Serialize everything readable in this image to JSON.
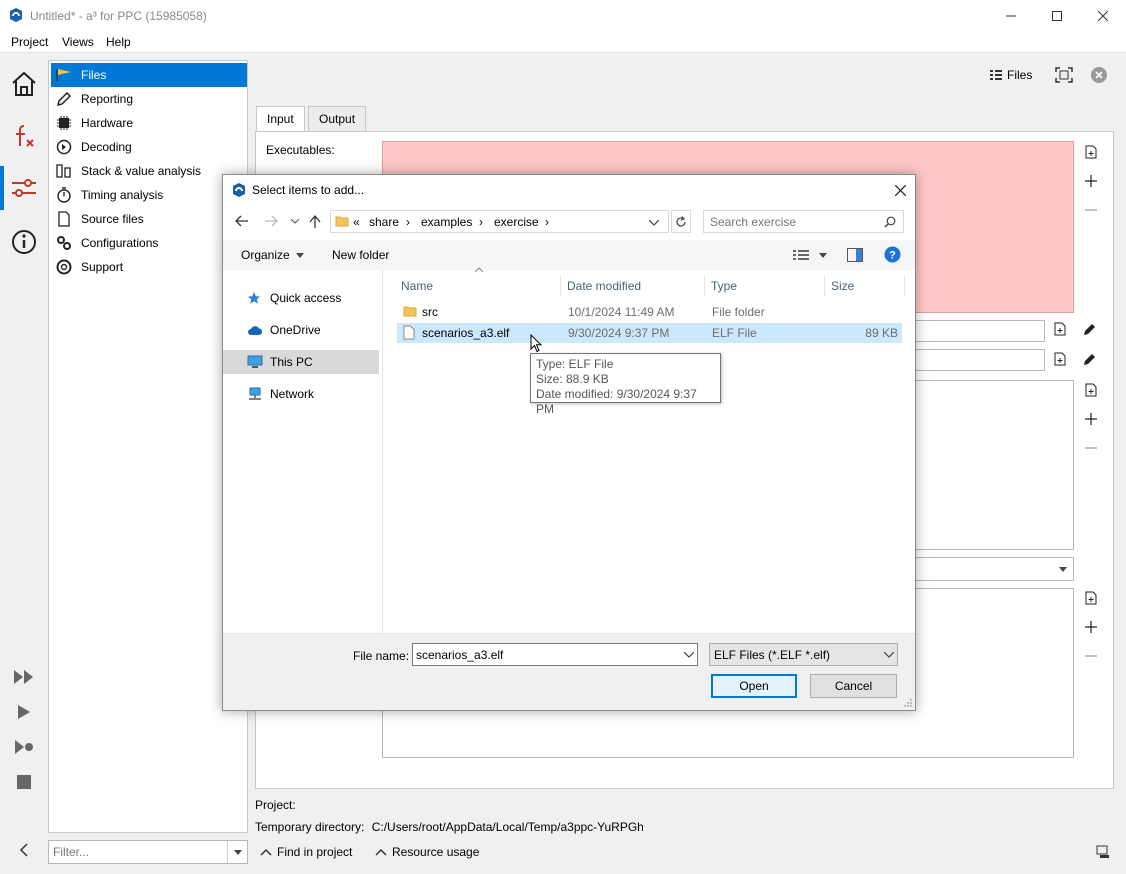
{
  "window": {
    "title": "Untitled* - a³ for PPC (15985058)"
  },
  "menu": [
    "Project",
    "Views",
    "Help"
  ],
  "nav": {
    "items": [
      {
        "label": "Files",
        "icon": "flag-icon"
      },
      {
        "label": "Reporting",
        "icon": "pencil-icon"
      },
      {
        "label": "Hardware",
        "icon": "chip-icon"
      },
      {
        "label": "Decoding",
        "icon": "decode-icon"
      },
      {
        "label": "Stack & value analysis",
        "icon": "stack-icon"
      },
      {
        "label": "Timing analysis",
        "icon": "stopwatch-icon"
      },
      {
        "label": "Source files",
        "icon": "document-icon"
      },
      {
        "label": "Configurations",
        "icon": "gears-icon"
      },
      {
        "label": "Support",
        "icon": "lifebuoy-icon"
      }
    ],
    "filter_placeholder": "Filter..."
  },
  "toolbar": {
    "files_label": "Files"
  },
  "tabs": [
    "Input",
    "Output"
  ],
  "input_panel": {
    "executables_label": "Executables:"
  },
  "footer": {
    "project_label": "Project:",
    "tempdir_label": "Temporary directory:",
    "tempdir_value": "C:/Users/root/AppData/Local/Temp/a3ppc-YuRPGh",
    "find_label": "Find in project",
    "resource_label": "Resource usage"
  },
  "dialog": {
    "title": "Select items to add...",
    "breadcrumb": [
      "«",
      "share",
      "examples",
      "exercise"
    ],
    "search_placeholder": "Search exercise",
    "organize_label": "Organize",
    "newfolder_label": "New folder",
    "pane": [
      {
        "label": "Quick access",
        "icon": "star-icon"
      },
      {
        "label": "OneDrive",
        "icon": "cloud-icon"
      },
      {
        "label": "This PC",
        "icon": "monitor-icon"
      },
      {
        "label": "Network",
        "icon": "network-icon"
      }
    ],
    "columns": [
      "Name",
      "Date modified",
      "Type",
      "Size"
    ],
    "files": [
      {
        "name": "src",
        "date": "10/1/2024 11:49 AM",
        "type": "File folder",
        "size": ""
      },
      {
        "name": "scenarios_a3.elf",
        "date": "9/30/2024 9:37 PM",
        "type": "ELF File",
        "size": "89 KB"
      }
    ],
    "tooltip": {
      "type": "Type: ELF File",
      "size": "Size: 88.9 KB",
      "modified": "Date modified: 9/30/2024 9:37 PM"
    },
    "filename_label": "File name:",
    "filename_value": "scenarios_a3.elf",
    "filetype_value": "ELF Files (*.ELF *.elf)",
    "open_label": "Open",
    "cancel_label": "Cancel"
  },
  "colors": {
    "accent": "#0078d7",
    "executables_bg": "#ffc8c8",
    "selection_bg": "#cce8ff"
  }
}
